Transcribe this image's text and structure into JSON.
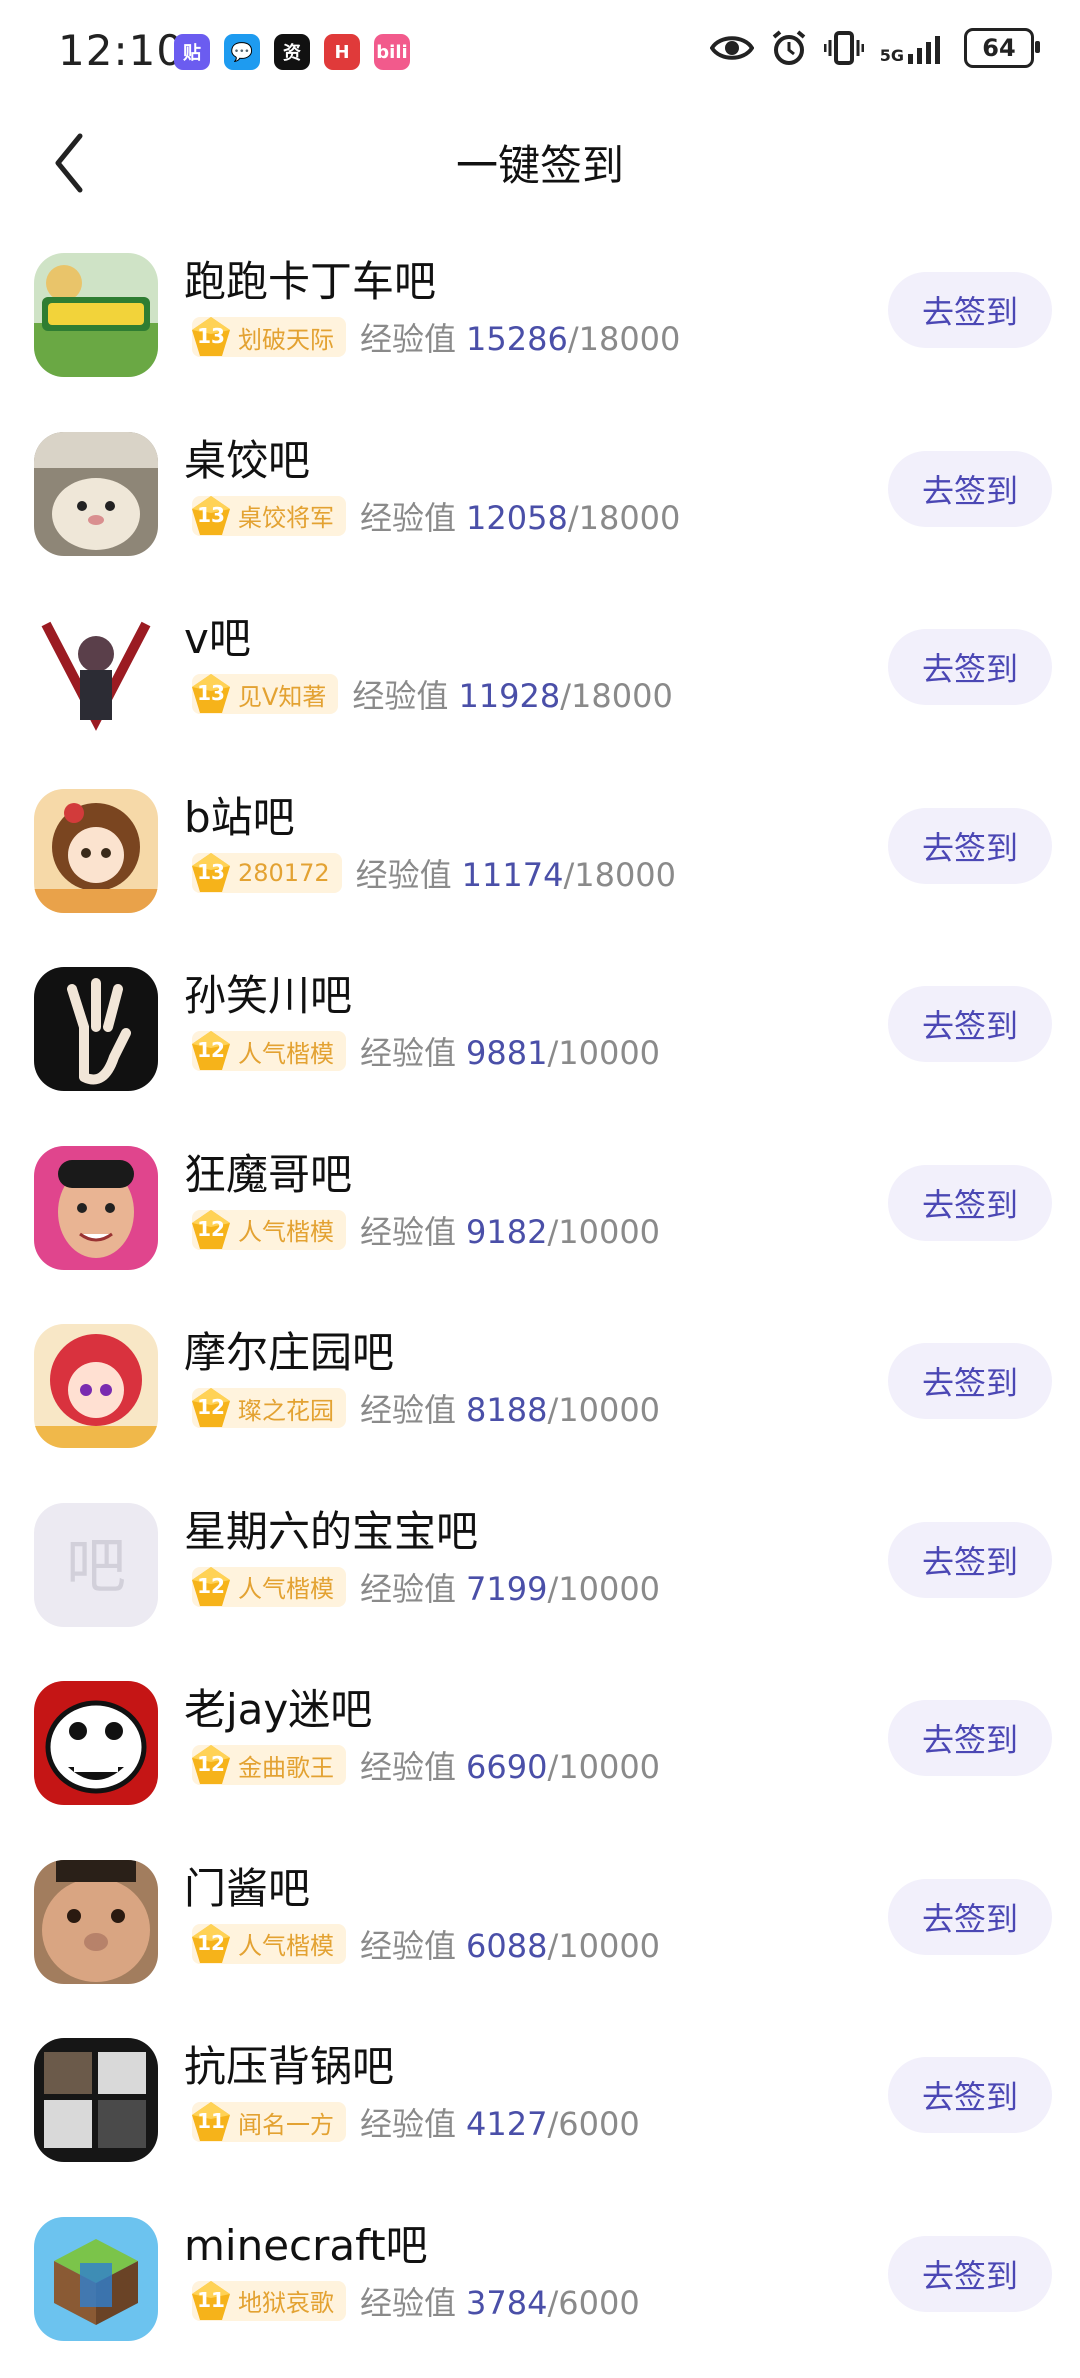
{
  "status_bar": {
    "time": "12:10",
    "network": "5G",
    "battery": "64",
    "app_icons": [
      {
        "icon": "tieba-icon",
        "label": "贴",
        "color": "#6b5cf0"
      },
      {
        "icon": "message-icon",
        "label": "💬",
        "color": "#1e9bf0"
      },
      {
        "icon": "news-icon",
        "label": "资",
        "color": "#111111"
      },
      {
        "icon": "huawei-icon",
        "label": "H",
        "color": "#e03a3a"
      },
      {
        "icon": "bilibili-icon",
        "label": "bili",
        "color": "#f25a8c"
      }
    ]
  },
  "header": {
    "title": "一键签到",
    "back_icon": "chevron-left-icon"
  },
  "colors": {
    "accent": "#4b47b4",
    "button_bg": "#f2f0fb",
    "badge_bg": "#fff3dd",
    "badge_text": "#e3a232",
    "exp_value": "#4a4fa8"
  },
  "exp_label": "经验值",
  "sign_label": "去签到",
  "forums": [
    {
      "name": "跑跑卡丁车吧",
      "level": "13",
      "badge": "划破天际",
      "exp": "15286",
      "exp_total": "/18000",
      "avatar": "kart",
      "color": "#4f9b5a"
    },
    {
      "name": "桌饺吧",
      "level": "13",
      "badge": "桌饺将军",
      "exp": "12058",
      "exp_total": "/18000",
      "avatar": "hamster",
      "color": "#a89b86"
    },
    {
      "name": "v吧",
      "level": "13",
      "badge": "见V知著",
      "exp": "11928",
      "exp_total": "/18000",
      "avatar": "v",
      "color": "#8c1d24"
    },
    {
      "name": "b站吧",
      "level": "13",
      "badge": "280172",
      "exp": "11174",
      "exp_total": "/18000",
      "avatar": "anime-girl",
      "color": "#c8865a"
    },
    {
      "name": "孙笑川吧",
      "level": "12",
      "badge": "人气楷模",
      "exp": "9881",
      "exp_total": "/10000",
      "avatar": "hand",
      "color": "#111111"
    },
    {
      "name": "狂魔哥吧",
      "level": "12",
      "badge": "人气楷模",
      "exp": "9182",
      "exp_total": "/10000",
      "avatar": "face",
      "color": "#d6418a"
    },
    {
      "name": "摩尔庄园吧",
      "level": "12",
      "badge": "璨之花园",
      "exp": "8188",
      "exp_total": "/10000",
      "avatar": "anime-red",
      "color": "#e24b5b"
    },
    {
      "name": "星期六的宝宝吧",
      "level": "12",
      "badge": "人气楷模",
      "exp": "7199",
      "exp_total": "/10000",
      "avatar": "placeholder",
      "color": "#eceaf3",
      "avatar_text": "吧"
    },
    {
      "name": "老jay迷吧",
      "level": "12",
      "badge": "金曲歌王",
      "exp": "6690",
      "exp_total": "/10000",
      "avatar": "rage",
      "color": "#c41616"
    },
    {
      "name": "门酱吧",
      "level": "12",
      "badge": "人气楷模",
      "exp": "6088",
      "exp_total": "/10000",
      "avatar": "face2",
      "color": "#b48a6a"
    },
    {
      "name": "抗压背锅吧",
      "level": "11",
      "badge": "闻名一方",
      "exp": "4127",
      "exp_total": "/6000",
      "avatar": "text-logo",
      "color": "#161616"
    },
    {
      "name": "minecraft吧",
      "level": "11",
      "badge": "地狱哀歌",
      "exp": "3784",
      "exp_total": "/6000",
      "avatar": "minecraft",
      "color": "#4aa0d8"
    }
  ]
}
